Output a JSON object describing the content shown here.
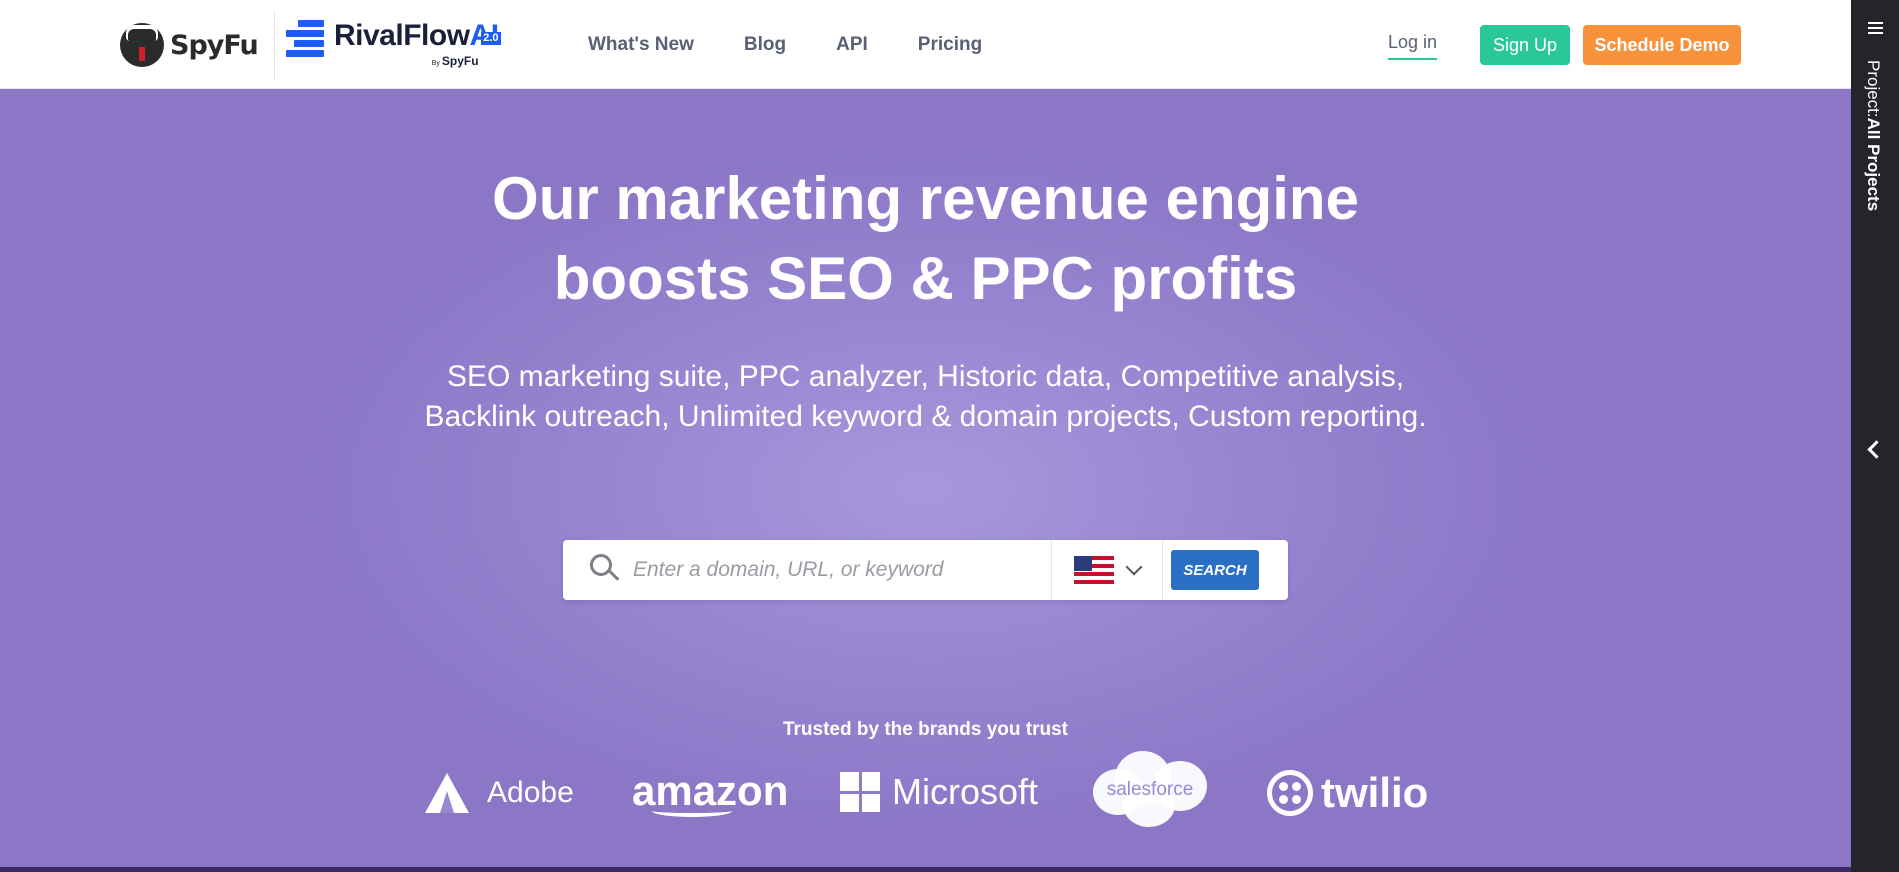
{
  "header": {
    "logo_spyfu": "SpyFu",
    "logo_rival": "RivalFlow",
    "logo_rival_ai": "AI",
    "logo_rival_version": "2.0",
    "logo_rival_by_small": "By",
    "logo_rival_by": "SpyFu",
    "nav": [
      "What's New",
      "Blog",
      "API",
      "Pricing"
    ],
    "login": "Log in",
    "signup": "Sign Up",
    "demo": "Schedule Demo"
  },
  "hero": {
    "title_line1": "Our marketing revenue engine",
    "title_line2": "boosts SEO & PPC profits",
    "subtitle": "SEO marketing suite, PPC analyzer, Historic data, Competitive analysis, Backlink outreach, Unlimited keyword & domain projects, Custom reporting."
  },
  "search": {
    "placeholder": "Enter a domain, URL, or keyword",
    "country": "United States",
    "button": "SEARCH"
  },
  "brands": {
    "heading": "Trusted by the brands you trust",
    "adobe": "Adobe",
    "amazon": "amazon",
    "microsoft": "Microsoft",
    "salesforce": "salesforce",
    "twilio": "twilio"
  },
  "side_panel": {
    "project_label": "Project:",
    "project_value": "All Projects"
  },
  "colors": {
    "accent_green": "#2ac898",
    "accent_orange": "#f7923a",
    "hero_purple": "#8e7cc9",
    "search_blue": "#2a6fc4"
  }
}
